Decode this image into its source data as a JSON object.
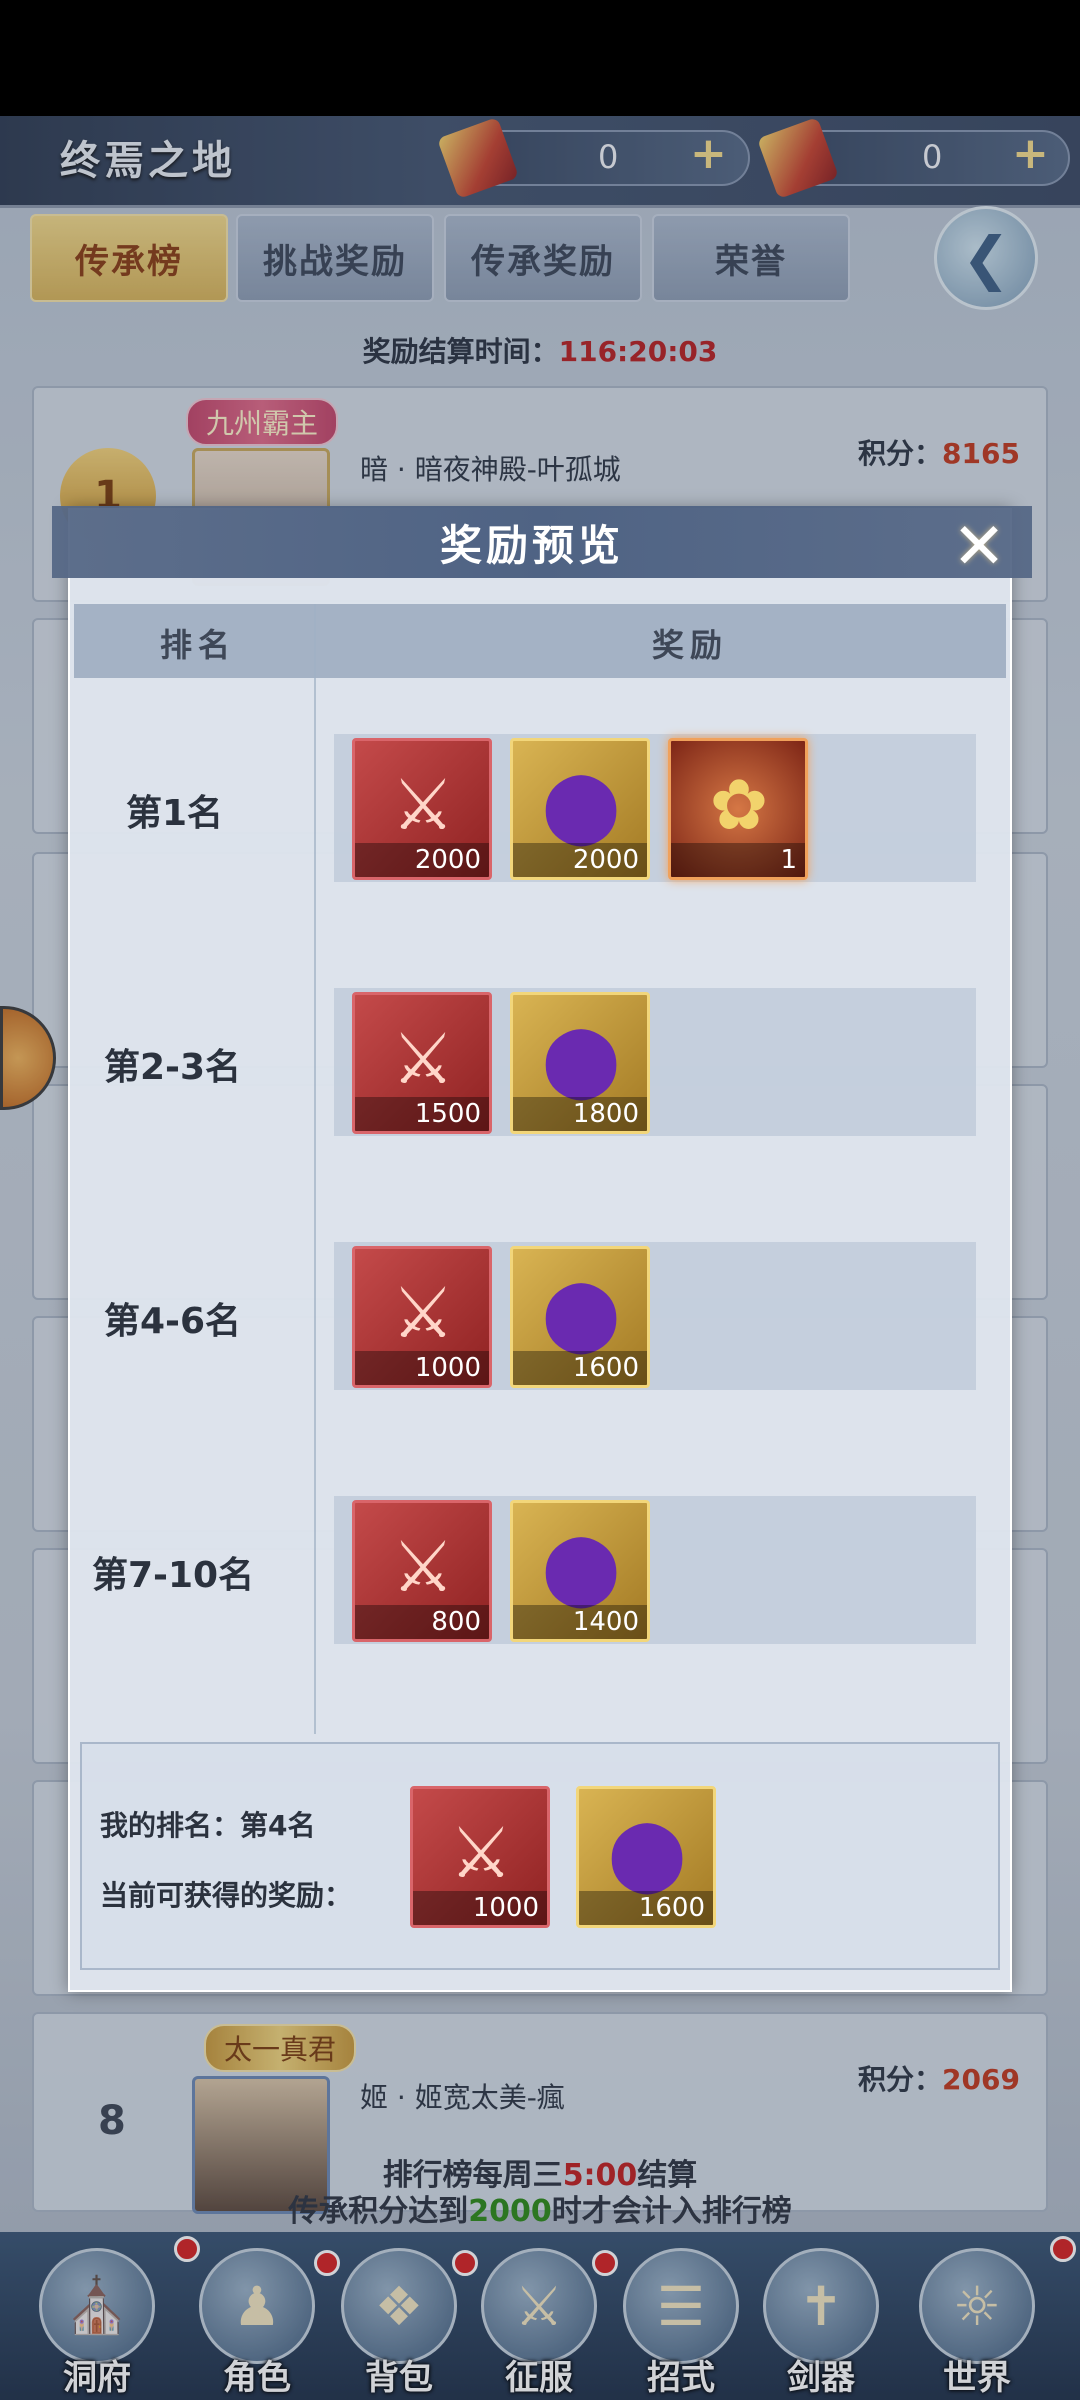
{
  "header": {
    "area_title": "终焉之地",
    "resources": [
      {
        "icon": "sword-token-icon",
        "value": "0",
        "plus": "+"
      },
      {
        "icon": "sword-token-icon",
        "value": "0",
        "plus": "+"
      }
    ]
  },
  "tabs": [
    {
      "label": "传承榜",
      "active": true
    },
    {
      "label": "挑战奖励",
      "active": false
    },
    {
      "label": "传承奖励",
      "active": false
    },
    {
      "label": "荣誉",
      "active": false
    }
  ],
  "settle": {
    "label": "奖励结算时间：",
    "time": "116:20:03"
  },
  "ranking": [
    {
      "rank": "1",
      "title_badge": "九州霸主",
      "name": "暗 · 暗夜神殿-叶孤城",
      "score_label": "积分：",
      "score": "8165"
    },
    {
      "rank": "8",
      "title_badge": "太一真君",
      "name": "姬 · 姬宽太美-瘋",
      "score_label": "积分：",
      "score": "2069"
    }
  ],
  "modal": {
    "title": "奖励预览",
    "col_rank": "排名",
    "col_reward": "奖励",
    "rows": [
      {
        "rank_label": "第1名",
        "items": [
          {
            "type": "red",
            "icon": "sword-scroll-icon",
            "count": "2000"
          },
          {
            "type": "gold",
            "icon": "purple-orb-icon",
            "count": "2000"
          },
          {
            "type": "title",
            "icon": "title-token-icon",
            "count": "1"
          }
        ]
      },
      {
        "rank_label": "第2-3名",
        "items": [
          {
            "type": "red",
            "icon": "sword-scroll-icon",
            "count": "1500"
          },
          {
            "type": "gold",
            "icon": "purple-orb-icon",
            "count": "1800"
          }
        ]
      },
      {
        "rank_label": "第4-6名",
        "items": [
          {
            "type": "red",
            "icon": "sword-scroll-icon",
            "count": "1000"
          },
          {
            "type": "gold",
            "icon": "purple-orb-icon",
            "count": "1600"
          }
        ]
      },
      {
        "rank_label": "第7-10名",
        "items": [
          {
            "type": "red",
            "icon": "sword-scroll-icon",
            "count": "800"
          },
          {
            "type": "gold",
            "icon": "purple-orb-icon",
            "count": "1400"
          }
        ]
      }
    ],
    "my_rank_label": "我的排名：",
    "my_rank_value": "第4名",
    "current_reward_label": "当前可获得的奖励：",
    "my_items": [
      {
        "type": "red",
        "icon": "sword-scroll-icon",
        "count": "1000"
      },
      {
        "type": "gold",
        "icon": "purple-orb-icon",
        "count": "1600"
      }
    ]
  },
  "bottom_note": {
    "line1_a": "排行榜每周三",
    "line1_time": "5:00",
    "line1_b": "结算",
    "line2_a": "传承积分达到",
    "line2_value": "2000",
    "line2_b": "时才会计入排行榜"
  },
  "nav": [
    {
      "label": "洞府",
      "icon": "pavilion-icon",
      "badge": true
    },
    {
      "label": "角色",
      "icon": "character-icon",
      "badge": true
    },
    {
      "label": "背包",
      "icon": "bag-icon",
      "badge": true
    },
    {
      "label": "征服",
      "icon": "crossed-swords-icon",
      "badge": true
    },
    {
      "label": "招式",
      "icon": "scroll-icon",
      "badge": false
    },
    {
      "label": "剑器",
      "icon": "sword-icon",
      "badge": false
    },
    {
      "label": "世界",
      "icon": "world-map-icon",
      "badge": true
    }
  ],
  "colors": {
    "accent_red": "#c0391e",
    "tab_active": "#d8b45a",
    "modal_header": "#4f6384"
  }
}
